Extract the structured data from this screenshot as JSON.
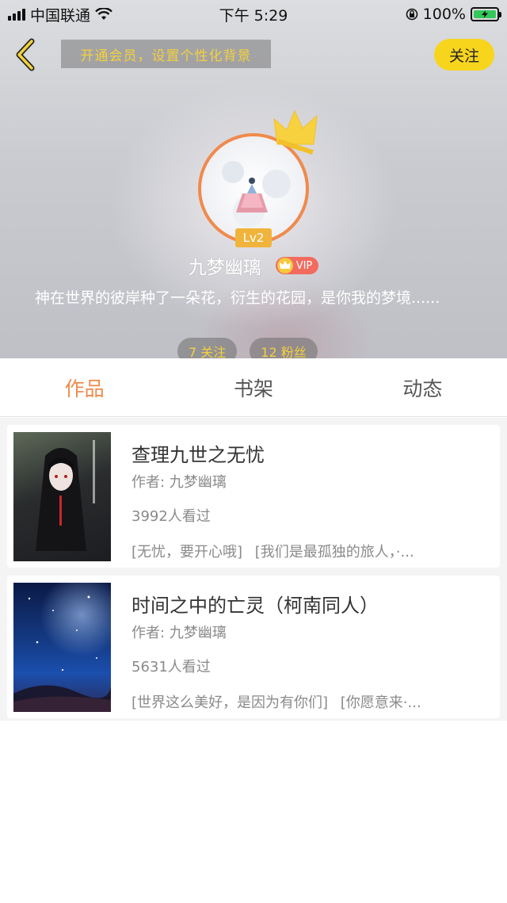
{
  "status_bar": {
    "carrier": "中国联通",
    "time": "下午 5:29",
    "battery": "100%"
  },
  "header": {
    "vip_background_text": "开通会员，设置个性化背景",
    "follow_label": "关注"
  },
  "profile": {
    "level": "Lv2",
    "username": "九梦幽璃",
    "vip_label": "VIP",
    "bio": "神在世界的彼岸种了一朵花，衍生的花园，是你我的梦境......",
    "following": "7 关注",
    "followers": "12 粉丝"
  },
  "tabs": [
    {
      "label": "作品",
      "active": true
    },
    {
      "label": "书架",
      "active": false
    },
    {
      "label": "动态",
      "active": false
    }
  ],
  "works": [
    {
      "title": "查理九世之无忧",
      "author": "作者: 九梦幽璃",
      "views": "3992人看过",
      "tags": [
        "[无忧，要开心哦]",
        "[我们是最孤独的旅人，·..."
      ]
    },
    {
      "title": "时间之中的亡灵（柯南同人）",
      "author": "作者: 九梦幽璃",
      "views": "5631人看过",
      "tags": [
        "[世界这么美好，是因为有你们]",
        "[你愿意来·..."
      ]
    }
  ],
  "colors": {
    "accent": "#f08a4b",
    "follow_button": "#f7d51d",
    "vip_text": "#f4d03f"
  }
}
